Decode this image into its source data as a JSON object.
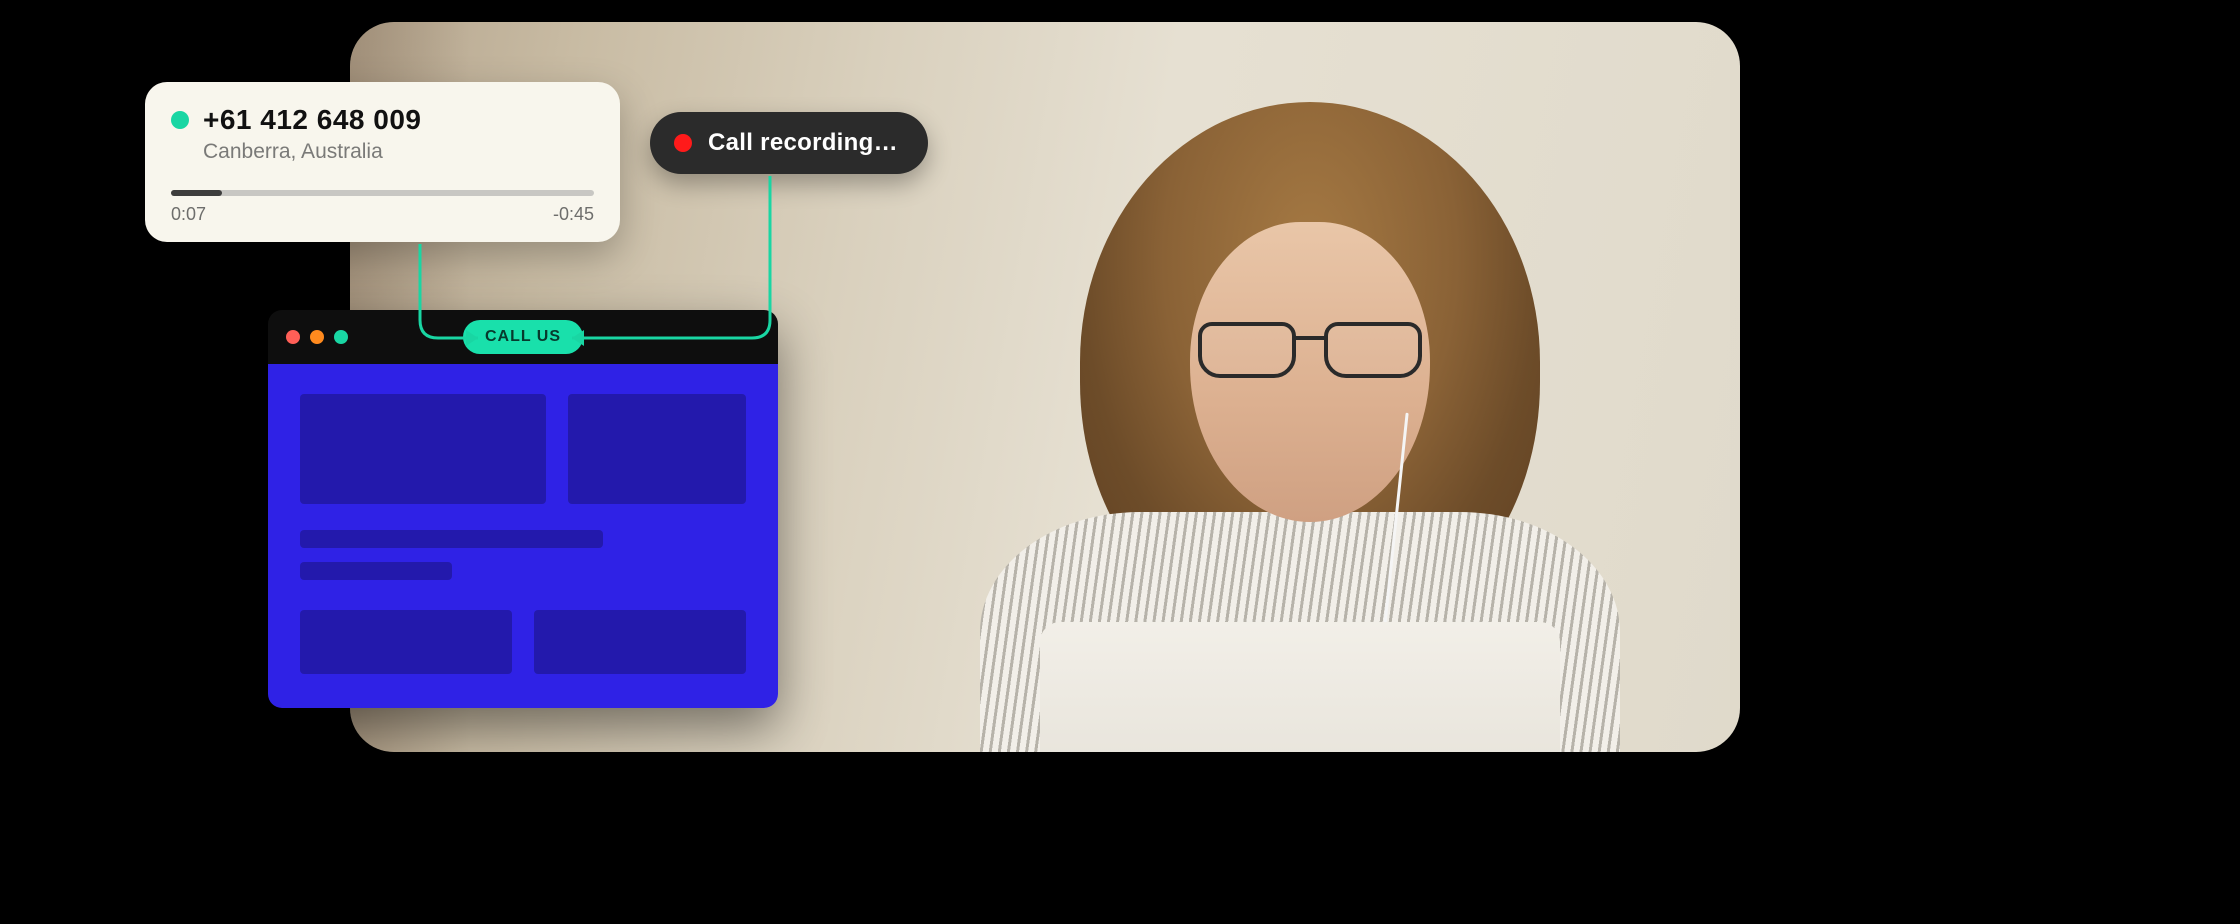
{
  "call_card": {
    "phone_number": "+61 412 648 009",
    "location": "Canberra, Australia",
    "elapsed": "0:07",
    "remaining": "-0:45",
    "progress_percent": 12,
    "status_color": "#19d6a3"
  },
  "recording": {
    "label": "Call recording…",
    "dot_color": "#ff1a1a"
  },
  "browser": {
    "call_button_label": "CALL US",
    "traffic_colors": [
      "#ff5f57",
      "#ff8a1e",
      "#19d6a3"
    ],
    "body_color": "#2f22e6"
  }
}
